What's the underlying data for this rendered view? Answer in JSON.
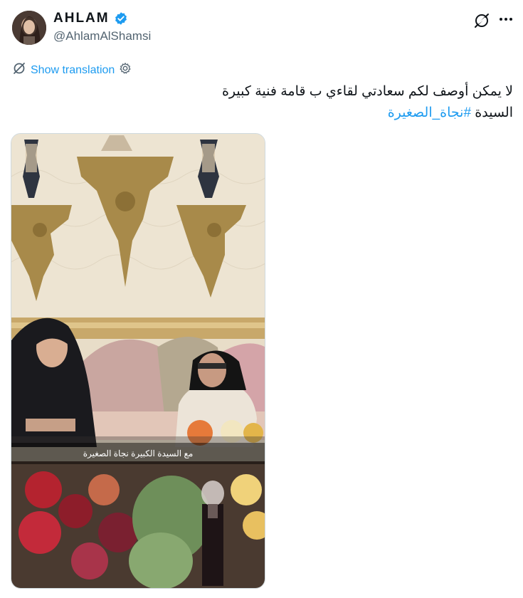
{
  "author": {
    "display_name": "AHLAM",
    "handle": "@AhlamAlShamsi",
    "avatar_icon": "profile-photo",
    "verified_icon": "verified-badge-icon",
    "verified_color": "#1d9bf0"
  },
  "actions": {
    "grok_icon": "grok-icon",
    "more_icon": "more-options-icon"
  },
  "translation": {
    "icon": "translate-icon",
    "label": "Show translation",
    "settings_icon": "gear-icon"
  },
  "tweet": {
    "line1": "لا يمكن أوصف لكم سعادتي لقاءي ب قامة فنية كبيرة",
    "line2_prefix": "السيدة ",
    "hashtag": "#نجاة_الصغيرة"
  },
  "media": {
    "caption": "مع السيدة الكبيرة نجاة الصغيرة"
  },
  "colors": {
    "link": "#1d9bf0",
    "text": "#0f1419",
    "secondary": "#536471"
  }
}
